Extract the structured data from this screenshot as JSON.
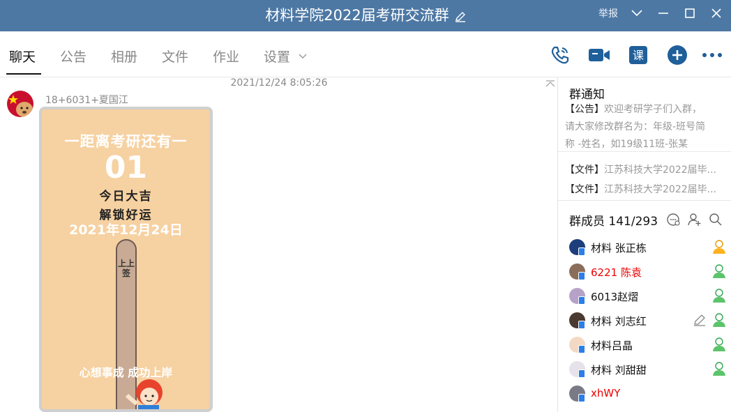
{
  "window": {
    "title": "材料学院2022届考研交流群",
    "report_label": "举报",
    "controls": [
      "chevron-down-icon",
      "minimize-icon",
      "maximize-icon",
      "close-icon"
    ],
    "titlebar_color": "#4d78a4"
  },
  "tabs": [
    {
      "label": "聊天",
      "active": true
    },
    {
      "label": "公告"
    },
    {
      "label": "相册"
    },
    {
      "label": "文件"
    },
    {
      "label": "作业"
    },
    {
      "label": "设置"
    }
  ],
  "toolbar": {
    "icons": [
      "phone-call-icon",
      "video-call-icon",
      "class-icon",
      "add-icon",
      "more-icon"
    ],
    "class_label": "课",
    "icon_color": "#1f5f9a"
  },
  "chat": {
    "timestamp": "2021/12/24 8:05:26",
    "sender": "18+6031+夏国江",
    "poster": {
      "headline": "一距离考研还有一",
      "count": "01",
      "line1": "今日大吉",
      "line2": "解锁好运",
      "date": "2021年12月24日",
      "stick": "上上签",
      "wish": "心想事成  成功上岸"
    }
  },
  "sidebar": {
    "notice_title": "群通知",
    "notice_tag": "【公告】",
    "notice_lines": [
      "欢迎考研学子们入群，",
      "请大家修改群名为：年级-班号简",
      "称 -姓名，如19级11班-张某"
    ],
    "files": [
      {
        "tag": "【文件】",
        "name": "江苏科技大学2022届毕..."
      },
      {
        "tag": "【文件】",
        "name": "江苏科技大学2022届毕..."
      }
    ],
    "members_label": "群成员 141/293",
    "members": [
      {
        "name": "材料 张正栋",
        "color": "#1d3e7a"
      },
      {
        "name": "6221 陈袁",
        "color": "#8b6d5c",
        "red": true
      },
      {
        "name": "6013赵熠",
        "color": "#b7a2c7"
      },
      {
        "name": "材料 刘志红",
        "color": "#4b3a2f"
      },
      {
        "name": "材料吕晶",
        "color": "#f3d9c4"
      },
      {
        "name": "材料 刘甜甜",
        "color": "#e6e2ea"
      },
      {
        "name": "xhWY",
        "color": "#7a7a86",
        "red": true
      }
    ]
  }
}
